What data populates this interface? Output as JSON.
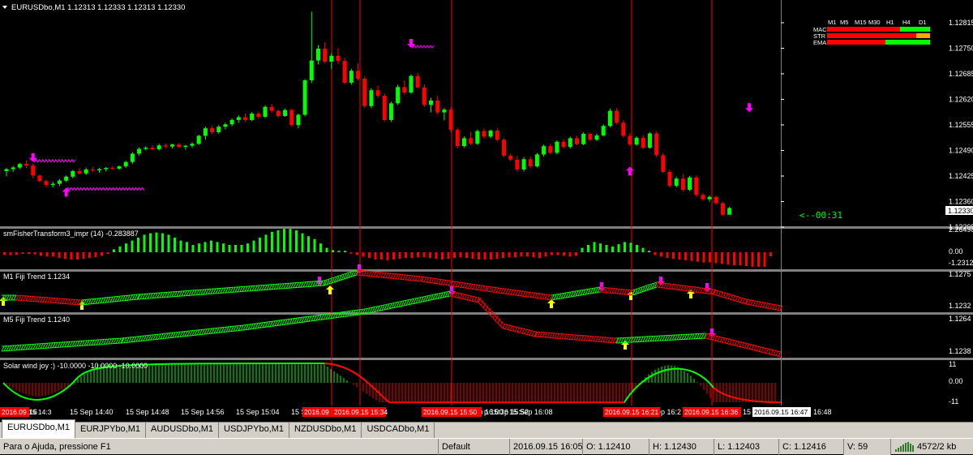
{
  "window": {
    "symbol_header": "EURUSDbo,M1  1.12313 1.12333 1.12313 1.12330"
  },
  "price_axis": {
    "labels": [
      "1.12815",
      "1.12750",
      "1.12685",
      "1.12620",
      "1.12555",
      "1.12490",
      "1.12425",
      "1.12360",
      "1.12295"
    ],
    "current_price": "1.12330",
    "timer": "<--00:31"
  },
  "mtf_table": {
    "timeframes": [
      "M1",
      "M5",
      "M15",
      "M30",
      "H1",
      "H4",
      "D1"
    ],
    "rows": [
      {
        "label": "MACD",
        "colors": [
          "#ff0000",
          "#ff0000",
          "#ff0000",
          "#ff0000",
          "#ff0000",
          "#00ff00",
          "#00ff00"
        ]
      },
      {
        "label": "STR",
        "colors": [
          "#ff0000",
          "#ff0000",
          "#ff0000",
          "#ff0000",
          "#ff0000",
          "#ff0000",
          "#ffa500"
        ]
      },
      {
        "label": "EMA",
        "colors": [
          "#ff0000",
          "#ff0000",
          "#ff0000",
          "#ff0000",
          "#00ff00",
          "#00ff00",
          "#00ff00"
        ]
      }
    ]
  },
  "indicators": {
    "fisher": {
      "title": "smFisherTransform3_impr  (14)  -0.283887",
      "axis": [
        "2.264985",
        "0.00",
        "-1.23129"
      ]
    },
    "m1_fiji": {
      "title": "M1 Fiji Trend 1.1234",
      "axis": [
        "1.1275",
        "1.1232"
      ]
    },
    "m5_fiji": {
      "title": "M5 Fiji Trend 1.1240",
      "axis": [
        "1.1264",
        "1.1238"
      ]
    },
    "solar": {
      "title": "Solar wind joy :) -10.0000 -10.0000 -10.0000",
      "axis": [
        "11",
        "0.00",
        "-11"
      ]
    }
  },
  "time_axis": {
    "labels": [
      "15 Sep 14:40",
      "15 Sep 14:48",
      "15 Sep 14:56",
      "15 Sep 15:04",
      "15 Sep 15:12",
      "15 Sep 15:36",
      "15 Sep 15:52",
      "15 Sep 16:00",
      "15 Sep 16:08",
      "16:48"
    ],
    "fragments": [
      "16",
      "p 15:36",
      "p 15:52",
      "ep 16:2",
      "15 S"
    ],
    "highlighted": [
      "2016.09.15 14:3",
      "2016.09",
      "2016.09.15 15:34",
      "2016.09.15 15:50",
      "2016.09.15 16:21",
      "2016.09.15 16:36"
    ],
    "current_time": "2016.09.15 16:47"
  },
  "tabs": [
    "EURUSDbo,M1",
    "EURJPYbo,M1",
    "AUDUSDbo,M1",
    "USDJPYbo,M1",
    "NZDUSDbo,M1",
    "USDCADbo,M1"
  ],
  "status_bar": {
    "help": "Para o Ajuda, pressione F1",
    "profile": "Default",
    "datetime": "2016.09.15 16:05",
    "open": "O: 1.12410",
    "high": "H: 1.12430",
    "low": "L: 1.12403",
    "close": "C: 1.12416",
    "volume": "V: 59",
    "traffic": "4572/2 kb"
  },
  "colors": {
    "bull": "#00ff00",
    "bear": "#ff0000",
    "arrow_down": "#ff00ff",
    "arrow_up": "#ffff00",
    "grid_line": "#ff0000",
    "text": "#ffffff"
  },
  "chart_data": {
    "type": "candlestick",
    "price_ylim": [
      1.1229,
      1.1283
    ],
    "candles": [
      [
        1.12423,
        1.12431,
        1.1241,
        1.12428
      ],
      [
        1.12428,
        1.12436,
        1.12421,
        1.12432
      ],
      [
        1.12432,
        1.12444,
        1.12428,
        1.12441
      ],
      [
        1.12441,
        1.1245,
        1.12431,
        1.12437
      ],
      [
        1.12437,
        1.12442,
        1.12405,
        1.12412
      ],
      [
        1.12412,
        1.12414,
        1.12395,
        1.12398
      ],
      [
        1.12398,
        1.12402,
        1.12382,
        1.12388
      ],
      [
        1.12388,
        1.12396,
        1.12382,
        1.12391
      ],
      [
        1.12391,
        1.12403,
        1.12386,
        1.12399
      ],
      [
        1.12399,
        1.12412,
        1.12395,
        1.12409
      ],
      [
        1.12409,
        1.12426,
        1.12405,
        1.12423
      ],
      [
        1.12423,
        1.12431,
        1.12414,
        1.12417
      ],
      [
        1.12417,
        1.12432,
        1.12413,
        1.12427
      ],
      [
        1.12427,
        1.12434,
        1.1242,
        1.12425
      ],
      [
        1.12425,
        1.12431,
        1.12419,
        1.12428
      ],
      [
        1.12428,
        1.12433,
        1.12422,
        1.12431
      ],
      [
        1.12431,
        1.12436,
        1.12426,
        1.12429
      ],
      [
        1.12429,
        1.12437,
        1.12427,
        1.12435
      ],
      [
        1.12435,
        1.12449,
        1.12431,
        1.12446
      ],
      [
        1.12446,
        1.12471,
        1.12441,
        1.12467
      ],
      [
        1.12467,
        1.12483,
        1.12462,
        1.12479
      ],
      [
        1.12479,
        1.12486,
        1.12475,
        1.12482
      ],
      [
        1.12482,
        1.12489,
        1.12476,
        1.12478
      ],
      [
        1.12478,
        1.12492,
        1.12475,
        1.12488
      ],
      [
        1.12488,
        1.12493,
        1.1248,
        1.12485
      ],
      [
        1.12485,
        1.12492,
        1.1248,
        1.1249
      ],
      [
        1.1249,
        1.12494,
        1.12482,
        1.12484
      ],
      [
        1.12484,
        1.12489,
        1.12477,
        1.12487
      ],
      [
        1.12487,
        1.12496,
        1.12482,
        1.12492
      ],
      [
        1.12492,
        1.12515,
        1.12489,
        1.12512
      ],
      [
        1.12512,
        1.12535,
        1.12502,
        1.12531
      ],
      [
        1.12531,
        1.12538,
        1.12516,
        1.12521
      ],
      [
        1.12521,
        1.12539,
        1.12517,
        1.12535
      ],
      [
        1.12535,
        1.12545,
        1.12528,
        1.12541
      ],
      [
        1.12541,
        1.12556,
        1.12536,
        1.12552
      ],
      [
        1.12552,
        1.12564,
        1.12545,
        1.12559
      ],
      [
        1.12559,
        1.12568,
        1.12548,
        1.12552
      ],
      [
        1.12552,
        1.12572,
        1.12549,
        1.12568
      ],
      [
        1.12568,
        1.12573,
        1.12556,
        1.1256
      ],
      [
        1.1256,
        1.12589,
        1.12557,
        1.12585
      ],
      [
        1.12585,
        1.12593,
        1.1257,
        1.12575
      ],
      [
        1.12575,
        1.12578,
        1.12558,
        1.12562
      ],
      [
        1.12562,
        1.12581,
        1.1256,
        1.12577
      ],
      [
        1.12577,
        1.12581,
        1.12535,
        1.12539
      ],
      [
        1.12539,
        1.12568,
        1.12531,
        1.12565
      ],
      [
        1.12565,
        1.12655,
        1.12561,
        1.12652
      ],
      [
        1.12652,
        1.12825,
        1.12645,
        1.12702
      ],
      [
        1.12702,
        1.12741,
        1.12692,
        1.12732
      ],
      [
        1.12732,
        1.12748,
        1.12695,
        1.12699
      ],
      [
        1.12699,
        1.12721,
        1.1268,
        1.12714
      ],
      [
        1.12714,
        1.12733,
        1.12693,
        1.12701
      ],
      [
        1.12701,
        1.12709,
        1.12642,
        1.12646
      ],
      [
        1.12646,
        1.12681,
        1.12641,
        1.12676
      ],
      [
        1.12676,
        1.12695,
        1.12652,
        1.12656
      ],
      [
        1.12656,
        1.12662,
        1.12582,
        1.12587
      ],
      [
        1.12587,
        1.12632,
        1.12582,
        1.12627
      ],
      [
        1.12627,
        1.12638,
        1.12608,
        1.12613
      ],
      [
        1.12613,
        1.12619,
        1.12548,
        1.12552
      ],
      [
        1.12552,
        1.12598,
        1.12547,
        1.12594
      ],
      [
        1.12594,
        1.12641,
        1.1259,
        1.12635
      ],
      [
        1.12635,
        1.12652,
        1.12616,
        1.12621
      ],
      [
        1.12621,
        1.12667,
        1.12618,
        1.12663
      ],
      [
        1.12663,
        1.12671,
        1.1263,
        1.12634
      ],
      [
        1.12634,
        1.12642,
        1.12585,
        1.1259
      ],
      [
        1.1259,
        1.12608,
        1.12571,
        1.12601
      ],
      [
        1.12601,
        1.12613,
        1.12566,
        1.12571
      ],
      [
        1.12571,
        1.12582,
        1.12551,
        1.12578
      ],
      [
        1.12578,
        1.12584,
        1.12521,
        1.12527
      ],
      [
        1.12527,
        1.12532,
        1.1248,
        1.12486
      ],
      [
        1.12486,
        1.12511,
        1.12482,
        1.12506
      ],
      [
        1.12506,
        1.12522,
        1.12488,
        1.12492
      ],
      [
        1.12492,
        1.12528,
        1.12489,
        1.12524
      ],
      [
        1.12524,
        1.12531,
        1.12505,
        1.1251
      ],
      [
        1.1251,
        1.12528,
        1.12506,
        1.12525
      ],
      [
        1.12525,
        1.12531,
        1.12498,
        1.12502
      ],
      [
        1.12502,
        1.12506,
        1.12458,
        1.12462
      ],
      [
        1.12462,
        1.12468,
        1.12448,
        1.12452
      ],
      [
        1.12452,
        1.12461,
        1.12421,
        1.12427
      ],
      [
        1.12427,
        1.12458,
        1.12422,
        1.12453
      ],
      [
        1.12453,
        1.12459,
        1.1243,
        1.12435
      ],
      [
        1.12435,
        1.12469,
        1.12432,
        1.12465
      ],
      [
        1.12465,
        1.1249,
        1.1246,
        1.12486
      ],
      [
        1.12486,
        1.12492,
        1.12465,
        1.12469
      ],
      [
        1.12469,
        1.12501,
        1.12465,
        1.12497
      ],
      [
        1.12497,
        1.12503,
        1.1248,
        1.12484
      ],
      [
        1.12484,
        1.1251,
        1.1248,
        1.12506
      ],
      [
        1.12506,
        1.12512,
        1.12488,
        1.12491
      ],
      [
        1.12491,
        1.12521,
        1.12488,
        1.12517
      ],
      [
        1.12517,
        1.1252,
        1.12498,
        1.12502
      ],
      [
        1.12502,
        1.12518,
        1.12499,
        1.12513
      ],
      [
        1.12513,
        1.12541,
        1.1251,
        1.12537
      ],
      [
        1.12537,
        1.12581,
        1.12533,
        1.12575
      ],
      [
        1.12575,
        1.12582,
        1.12541,
        1.12545
      ],
      [
        1.12545,
        1.12551,
        1.12508,
        1.12512
      ],
      [
        1.12512,
        1.12519,
        1.12486,
        1.1249
      ],
      [
        1.1249,
        1.12511,
        1.12487,
        1.12507
      ],
      [
        1.12507,
        1.12513,
        1.12478,
        1.12482
      ],
      [
        1.12482,
        1.12521,
        1.12479,
        1.12518
      ],
      [
        1.12518,
        1.12523,
        1.12458,
        1.12463
      ],
      [
        1.12463,
        1.12469,
        1.12418,
        1.12421
      ],
      [
        1.12421,
        1.12426,
        1.12381,
        1.12386
      ],
      [
        1.12386,
        1.12409,
        1.12382,
        1.12404
      ],
      [
        1.12404,
        1.12415,
        1.12372,
        1.12376
      ],
      [
        1.12376,
        1.12411,
        1.12373,
        1.12407
      ],
      [
        1.12407,
        1.12412,
        1.12358,
        1.12363
      ],
      [
        1.12363,
        1.12368,
        1.12348,
        1.12352
      ],
      [
        1.12352,
        1.12362,
        1.12346,
        1.12358
      ],
      [
        1.12358,
        1.12361,
        1.12338,
        1.12342
      ],
      [
        1.12342,
        1.12346,
        1.1231,
        1.12313
      ],
      [
        1.12313,
        1.12333,
        1.12313,
        1.1233
      ]
    ],
    "down_arrows": [
      [
        4,
        1.12452
      ],
      [
        61,
        1.1274
      ],
      [
        112,
        1.12578
      ]
    ],
    "up_arrows": [
      [
        9,
        1.12375
      ],
      [
        94,
        1.12428
      ]
    ],
    "fisher_hist": [
      -0.18,
      -0.2,
      -0.18,
      -0.12,
      -0.12,
      -0.15,
      -0.25,
      -0.3,
      -0.3,
      -0.4,
      -0.45,
      -0.5,
      -0.5,
      -0.45,
      -0.4,
      -0.35,
      -0.25,
      -0.12,
      0.2,
      0.4,
      0.6,
      0.8,
      1.0,
      1.2,
      1.3,
      1.35,
      1.3,
      1.2,
      1.0,
      0.8,
      0.7,
      0.5,
      0.6,
      0.7,
      0.8,
      0.7,
      0.6,
      0.5,
      0.5,
      0.5,
      0.6,
      0.8,
      1.0,
      1.2,
      1.4,
      1.5,
      1.6,
      1.6,
      1.5,
      1.3,
      1.1,
      0.9,
      0.6,
      0.3,
      0.15,
      0.1,
      0.1,
      -0.1,
      -0.2,
      -0.3,
      -0.4,
      -0.5,
      -0.5,
      -0.55,
      -0.5,
      -0.45,
      -0.4,
      -0.4,
      -0.35,
      -0.35,
      -0.4,
      -0.45,
      -0.5,
      -0.45,
      -0.4,
      -0.35,
      -0.4,
      -0.45,
      -0.5,
      -0.5,
      -0.5,
      -0.45,
      -0.4,
      -0.35,
      -0.35,
      -0.3,
      -0.3,
      -0.35,
      -0.4,
      -0.3,
      -0.2,
      -0.2,
      -0.25,
      -0.3,
      -0.25,
      0.3,
      0.5,
      0.7,
      0.6,
      0.5,
      0.4,
      0.55,
      0.7,
      0.65,
      0.5,
      0.3,
      0.1,
      -0.2,
      -0.3,
      -0.4,
      -0.45,
      -0.5,
      -0.55,
      -0.6,
      -0.65,
      -0.7,
      -0.7,
      -0.75,
      -0.8,
      -0.85,
      -0.9,
      -0.9,
      -0.95,
      -1.0,
      -1.0,
      -1.0,
      -0.28
    ]
  }
}
